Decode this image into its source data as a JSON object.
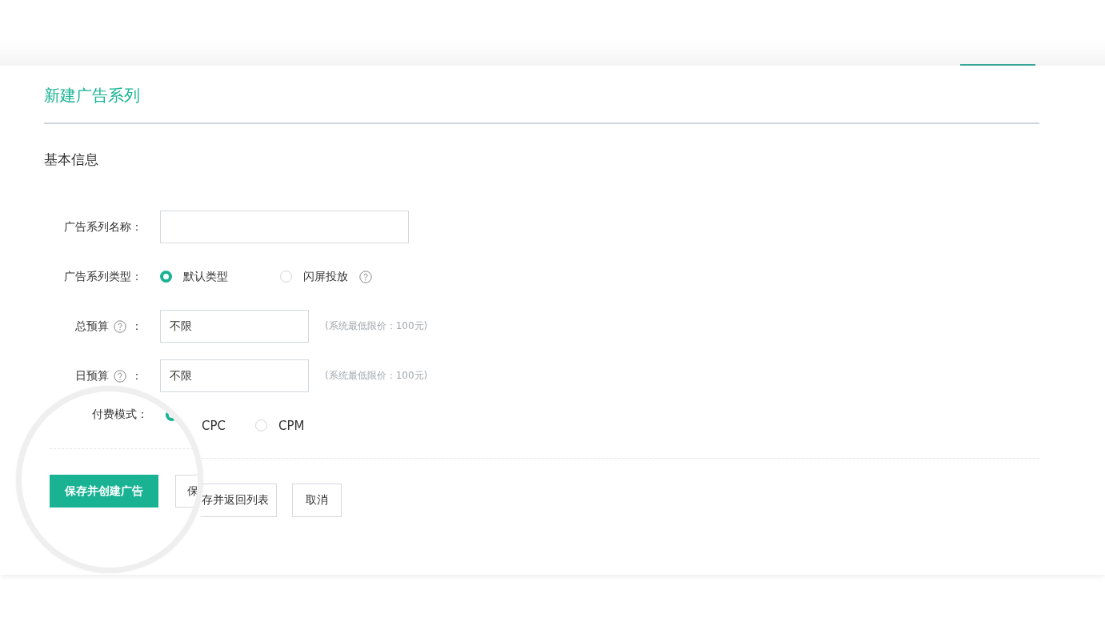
{
  "title": "新建广告系列",
  "section": "基本信息",
  "fields": [
    {
      "kind": "text",
      "label": "广告系列名称："
    },
    {
      "kind": "radio",
      "label": "广告系列类型：",
      "options": [
        {
          "label": "默认类型",
          "selected": true,
          "help": false
        },
        {
          "label": "闪屏投放",
          "selected": false,
          "help": true
        }
      ]
    },
    {
      "kind": "text",
      "label": "总预算",
      "help": true,
      "colon": "：",
      "value": "不限",
      "hint": "(系统最低限价：100元)"
    },
    {
      "kind": "text",
      "label": "日预算",
      "help": true,
      "colon": "：",
      "value": "不限",
      "hint": "(系统最低限价：100元)"
    },
    {
      "kind": "payment",
      "options": [
        {
          "label": "CPC",
          "selected": true
        },
        {
          "label": "CPM",
          "selected": false
        }
      ]
    }
  ],
  "magnifier": {
    "label": "付费模式：",
    "primary_button": "保存并创建广告",
    "partial_button": "保"
  },
  "buttons": [
    {
      "label": "存并返回列表"
    },
    {
      "label": "取消"
    }
  ]
}
